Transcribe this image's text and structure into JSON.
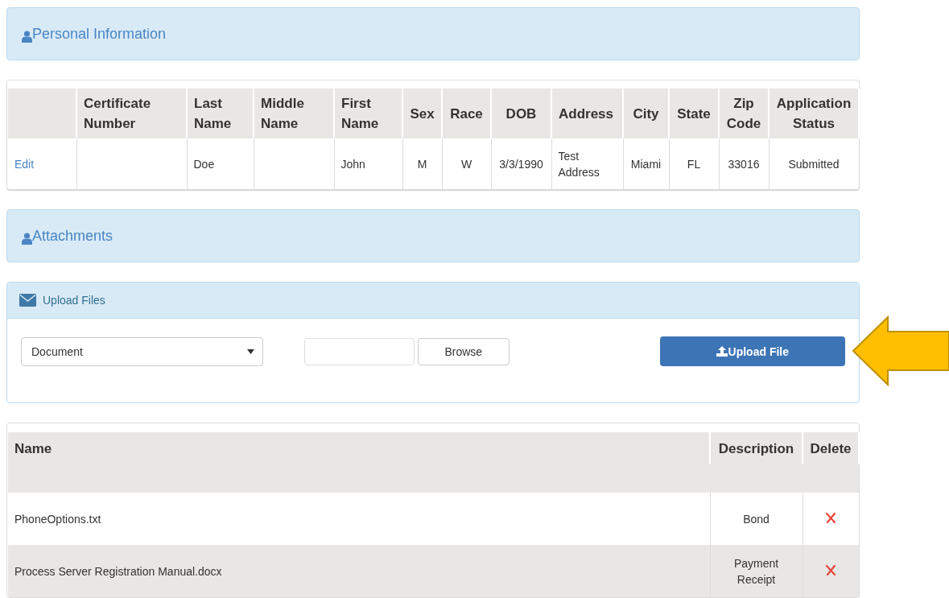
{
  "personal_panel": {
    "title": "Personal Information"
  },
  "person_table": {
    "columns": [
      "",
      "Certificate Number",
      "Last Name",
      "Middle Name",
      "First Name",
      "Sex",
      "Race",
      "DOB",
      "Address",
      "City",
      "State",
      "Zip Code",
      "Application Status"
    ],
    "rows": [
      {
        "cells": [
          "Edit",
          "",
          "Doe",
          "",
          "John",
          "M",
          "W",
          "3/3/1990",
          "Test Address",
          "Miami",
          "FL",
          "33016",
          "Submitted"
        ]
      }
    ]
  },
  "attachments_panel": {
    "title": "Attachments"
  },
  "upload_panel": {
    "title": "Upload Files",
    "document_type": "Document",
    "browse_button": "Browse",
    "upload_button": "Upload File"
  },
  "files_table": {
    "columns": [
      "Name",
      "Description",
      "Delete"
    ],
    "rows": [
      {
        "name": "PhoneOptions.txt",
        "description": "Bond"
      },
      {
        "name": "Process Server Registration Manual.docx",
        "description": "Payment Receipt"
      }
    ]
  }
}
